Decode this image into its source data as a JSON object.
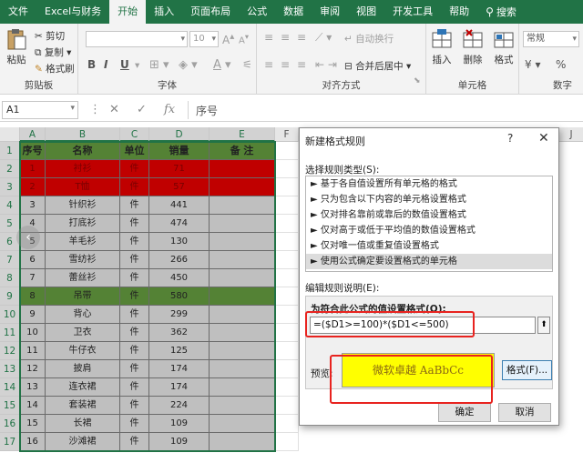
{
  "ribbon": {
    "tabs": [
      {
        "label": "文件"
      },
      {
        "label": "Excel与财务"
      },
      {
        "label": "开始"
      },
      {
        "label": "插入"
      },
      {
        "label": "页面布局"
      },
      {
        "label": "公式"
      },
      {
        "label": "数据"
      },
      {
        "label": "审阅"
      },
      {
        "label": "视图"
      },
      {
        "label": "开发工具"
      },
      {
        "label": "帮助"
      },
      {
        "label": "搜索"
      }
    ],
    "clipboard": {
      "paste": "粘贴",
      "cut": "剪切",
      "copy": "复制",
      "painter": "格式刷",
      "group": "剪贴板"
    },
    "font": {
      "size": "10",
      "group": "字体"
    },
    "alignment": {
      "wrap": "自动换行",
      "merge": "合并后居中",
      "group": "对齐方式"
    },
    "cells": {
      "insert": "插入",
      "delete": "删除",
      "format": "格式",
      "group": "单元格"
    },
    "number": {
      "format_value": "常规",
      "group": "数字"
    }
  },
  "formula_bar": {
    "name_box": "A1",
    "fx": "fx",
    "content": "序号"
  },
  "grid": {
    "columns": [
      "A",
      "B",
      "C",
      "D",
      "E",
      "F",
      "J"
    ],
    "headers": [
      "序号",
      "名称",
      "单位",
      "销量",
      "备  注"
    ],
    "rows": [
      {
        "no": "1",
        "name": "衬衫",
        "unit": "件",
        "qty": "71"
      },
      {
        "no": "2",
        "name": "T恤",
        "unit": "件",
        "qty": "57"
      },
      {
        "no": "3",
        "name": "针织衫",
        "unit": "件",
        "qty": "441"
      },
      {
        "no": "4",
        "name": "打底衫",
        "unit": "件",
        "qty": "474"
      },
      {
        "no": "5",
        "name": "羊毛衫",
        "unit": "件",
        "qty": "130"
      },
      {
        "no": "6",
        "name": "雪纺衫",
        "unit": "件",
        "qty": "266"
      },
      {
        "no": "7",
        "name": "蕾丝衫",
        "unit": "件",
        "qty": "450"
      },
      {
        "no": "8",
        "name": "吊带",
        "unit": "件",
        "qty": "580"
      },
      {
        "no": "9",
        "name": "背心",
        "unit": "件",
        "qty": "299"
      },
      {
        "no": "10",
        "name": "卫衣",
        "unit": "件",
        "qty": "362"
      },
      {
        "no": "11",
        "name": "牛仔衣",
        "unit": "件",
        "qty": "125"
      },
      {
        "no": "12",
        "name": "披肩",
        "unit": "件",
        "qty": "174"
      },
      {
        "no": "13",
        "name": "连衣裙",
        "unit": "件",
        "qty": "174"
      },
      {
        "no": "14",
        "name": "套装裙",
        "unit": "件",
        "qty": "224"
      },
      {
        "no": "15",
        "name": "长裙",
        "unit": "件",
        "qty": "109"
      },
      {
        "no": "16",
        "name": "沙滩裙",
        "unit": "件",
        "qty": "109"
      }
    ],
    "row_fill": {
      "header": "#548235",
      "red": "#c00000",
      "green": "#548235",
      "gray": "#bfbfbf"
    },
    "red_rows": [
      1,
      2
    ],
    "green_rows": [
      8
    ]
  },
  "dialog": {
    "title": "新建格式规则",
    "help": "?",
    "close": "✕",
    "rule_type_label": "选择规则类型(S):",
    "rule_types": [
      "► 基于各自值设置所有单元格的格式",
      "► 只为包含以下内容的单元格设置格式",
      "► 仅对排名靠前或靠后的数值设置格式",
      "► 仅对高于或低于平均值的数值设置格式",
      "► 仅对唯一值或重复值设置格式",
      "► 使用公式确定要设置格式的单元格"
    ],
    "edit_label": "编辑规则说明(E):",
    "edit_title": "为符合此公式的值设置格式(O):",
    "formula": "=($D1>=100)*($D1<=500)",
    "preview_label": "预览:",
    "preview_text": "微软卓越   AaBbCc",
    "format_button": "格式(F)...",
    "ok": "确定",
    "cancel": "取消"
  },
  "colors": {
    "excel_green": "#217346",
    "highlight_red": "#e8231f",
    "preview_fill": "#ffff00"
  }
}
